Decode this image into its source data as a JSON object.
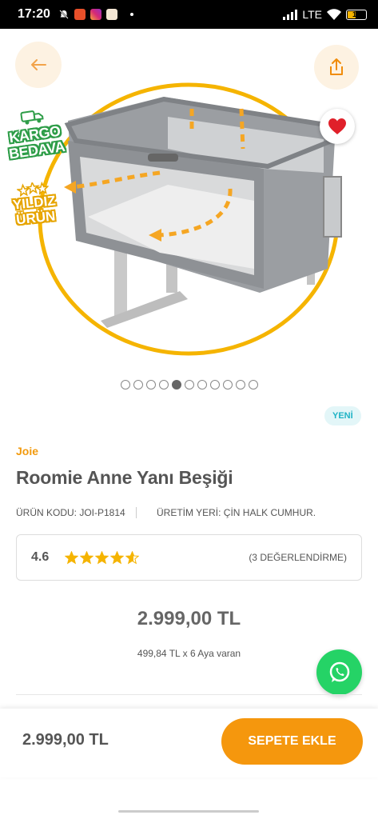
{
  "status_bar": {
    "time": "17:20",
    "network": "LTE",
    "battery": "15"
  },
  "badges": {
    "kargo_line1": "KARGO",
    "kargo_line2": "BEDAVA",
    "yildiz_line1": "YILDIZ",
    "yildiz_line2": "ÜRÜN"
  },
  "pager": {
    "total": 11,
    "active_index": 4
  },
  "product": {
    "new_label": "YENİ",
    "brand": "Joie",
    "title": "Roomie Anne Yanı Beşiği",
    "code": "ÜRÜN KODU: JOI-P1814",
    "origin": "ÜRETİM YERİ: ÇİN HALK CUMHUR.",
    "rating": "4.6",
    "rating_stars": 4.6,
    "rating_count": "(3 DEĞERLENDİRME)",
    "price": "2.999,00 TL",
    "installment": "499,84 TL x 6 Aya varan"
  },
  "bottom_bar": {
    "price": "2.999,00 TL",
    "add_to_cart": "SEPETE EKLE"
  },
  "colors": {
    "accent": "#f5970d",
    "brand": "#f29a0e",
    "whatsapp": "#25d366",
    "heart": "#e0202a"
  }
}
